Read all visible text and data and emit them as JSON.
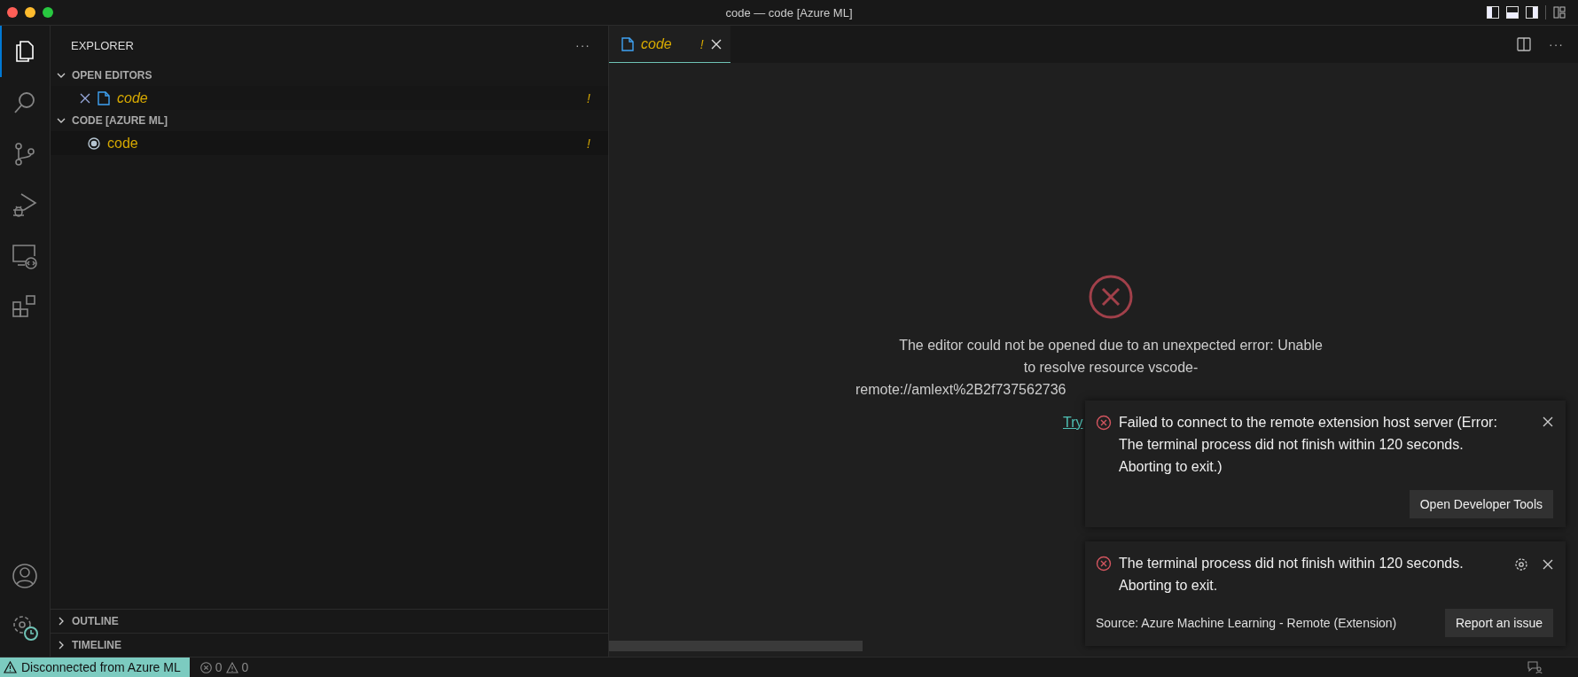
{
  "window": {
    "title": "code — code [Azure ML]"
  },
  "activity_bar": {
    "items": [
      {
        "kind": "explorer",
        "selected": true
      },
      {
        "kind": "search",
        "selected": false
      },
      {
        "kind": "source-control",
        "selected": false
      },
      {
        "kind": "run-debug",
        "selected": false
      },
      {
        "kind": "remote",
        "selected": false
      },
      {
        "kind": "extensions",
        "selected": false
      }
    ],
    "bottom": [
      {
        "kind": "account"
      },
      {
        "kind": "manage"
      }
    ]
  },
  "sidebar": {
    "title": "EXPLORER",
    "more": "···",
    "sections": [
      {
        "title": "OPEN EDITORS",
        "expanded": true,
        "items": [
          {
            "kind": "open-editor",
            "label": "code",
            "badge": "!",
            "selected": false
          }
        ]
      },
      {
        "title": "CODE [AZURE ML]",
        "expanded": true,
        "items": [
          {
            "kind": "folder",
            "label": "code",
            "badge": "!",
            "selected": true
          }
        ]
      }
    ],
    "bottom_sections": [
      {
        "title": "OUTLINE",
        "expanded": false
      },
      {
        "title": "TIMELINE",
        "expanded": false
      }
    ]
  },
  "tabs": [
    {
      "label": "code",
      "badge": "!",
      "selected": true
    }
  ],
  "editor": {
    "more": "···",
    "lines": [
      "The editor could not be opened due to an unexpected error: Unable",
      "to resolve resource vscode-",
      "remote://amlext%2B2f737562736"
    ],
    "link": "Try"
  },
  "notifications": [
    {
      "message": "Failed to connect to the remote extension host server (Error: The terminal process did not finish within 120 seconds. Aborting to exit.)",
      "settings": false,
      "button": "Open Developer Tools"
    },
    {
      "message": "The terminal process did not finish within 120 seconds. Aborting to exit.",
      "settings": true,
      "source": "Source: Azure Machine Learning - Remote (Extension)",
      "button": "Report an issue"
    }
  ],
  "status_bar": {
    "remote": "Disconnected from Azure ML",
    "errors": "0",
    "warnings": "0"
  }
}
